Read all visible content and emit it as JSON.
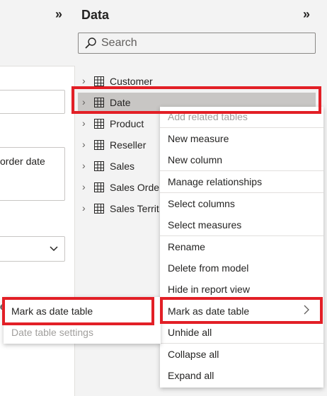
{
  "left_pane": {
    "textarea_text": "order date",
    "partial_letter": "e"
  },
  "data_pane": {
    "title": "Data",
    "search_placeholder": "Search",
    "tables": [
      "Customer",
      "Date",
      "Product",
      "Reseller",
      "Sales",
      "Sales Orde",
      "Sales Territ"
    ],
    "selected_table": "Date"
  },
  "context_menu": {
    "items": {
      "add_related_tables": "Add related tables",
      "new_measure": "New measure",
      "new_column": "New column",
      "manage_relationships": "Manage relationships",
      "select_columns": "Select columns",
      "select_measures": "Select measures",
      "rename": "Rename",
      "delete_from_model": "Delete from model",
      "hide_in_report_view": "Hide in report view",
      "mark_as_date_table": "Mark as date table",
      "unhide_all": "Unhide all",
      "collapse_all": "Collapse all",
      "expand_all": "Expand all"
    }
  },
  "submenu": {
    "mark_as_date_table": "Mark as date table",
    "date_table_settings": "Date table settings"
  },
  "colors": {
    "highlight": "#e21f26",
    "selected_row": "#c8c6c4",
    "disabled_text": "#a19f9d"
  }
}
